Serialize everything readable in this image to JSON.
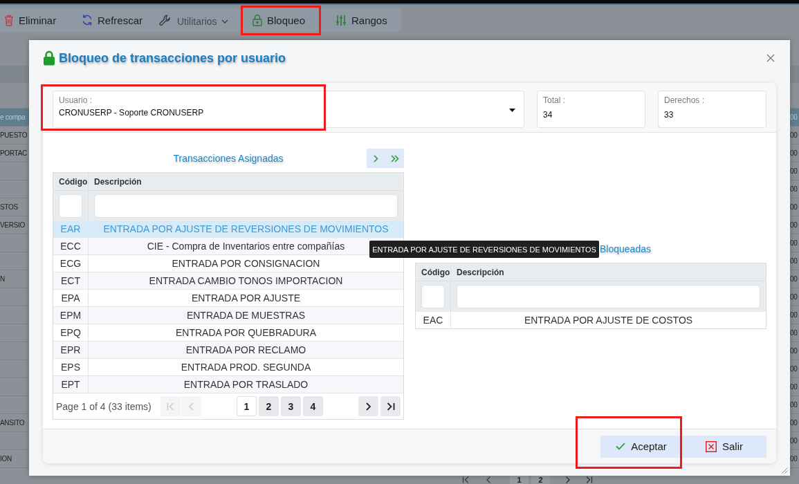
{
  "toolbar": {
    "items": [
      {
        "label": "Eliminar",
        "kind": "delete",
        "disabled": false,
        "highlighted": false
      },
      {
        "label": "Refrescar",
        "kind": "refresh",
        "disabled": false,
        "highlighted": false
      },
      {
        "label": "Utilitarios",
        "kind": "tools",
        "disabled": true,
        "highlighted": false
      },
      {
        "label": "Bloqueo",
        "kind": "lock",
        "disabled": false,
        "highlighted": true
      },
      {
        "label": "Rangos",
        "kind": "ranges",
        "disabled": false,
        "highlighted": false
      }
    ]
  },
  "background_grid": {
    "rows": [
      {
        "column_1": "e compa",
        "column_2": "00",
        "selected": true
      },
      {
        "column_1": "PUESTO",
        "column_2": "00",
        "selected": false
      },
      {
        "column_1": "PORTAC",
        "column_2": "00",
        "selected": false
      },
      {
        "column_2": "00",
        "selected": false
      },
      {
        "column_2": "00",
        "selected": false
      },
      {
        "column_1": "STOS",
        "column_2": "00",
        "selected": false
      },
      {
        "column_1": "VERSIO",
        "column_2": "00",
        "selected": false
      },
      {
        "column_2": "00",
        "selected": false
      },
      {
        "column_2": "00",
        "selected": false
      },
      {
        "column_1": "N",
        "column_2": "00",
        "selected": false
      },
      {
        "column_2": "00",
        "selected": false
      },
      {
        "column_2": "00",
        "selected": false
      },
      {
        "column_2": "00",
        "selected": false
      },
      {
        "column_2": "00",
        "selected": false
      },
      {
        "column_2": "00",
        "selected": false
      },
      {
        "column_2": "00",
        "selected": false
      },
      {
        "column_2": "00",
        "selected": false
      },
      {
        "column_1": "ANSITO",
        "column_2": "00",
        "selected": false
      },
      {
        "column_2": "00",
        "selected": false
      },
      {
        "column_1": "ION",
        "column_2": "00",
        "selected": false
      }
    ],
    "pager": {
      "pages": [
        "1",
        "2"
      ]
    }
  },
  "dialog": {
    "title": "Bloqueo de transacciones por usuario",
    "user_field": {
      "label": "Usuario :",
      "value": "CRONUSERP - Soporte CRONUSERP",
      "highlighted": true
    },
    "stats": [
      {
        "label": "Total :",
        "value": "34"
      },
      {
        "label": "Derechos :",
        "value": "33"
      }
    ],
    "assigned": {
      "title": "Transacciones Asignadas",
      "columns": [
        "Código",
        "Descripción"
      ],
      "rows": [
        {
          "code": "EAR",
          "description": "ENTRADA POR AJUSTE DE REVERSIONES DE MOVIMIENTOS",
          "selected": true
        },
        {
          "code": "ECC",
          "description": "CIE - Compra de Inventarios entre compañías",
          "selected": false
        },
        {
          "code": "ECG",
          "description": "ENTRADA POR CONSIGNACION",
          "selected": false
        },
        {
          "code": "ECT",
          "description": "ENTRADA CAMBIO TONOS IMPORTACION",
          "selected": false
        },
        {
          "code": "EPA",
          "description": "ENTRADA POR AJUSTE",
          "selected": false
        },
        {
          "code": "EPM",
          "description": "ENTRADA DE MUESTRAS",
          "selected": false
        },
        {
          "code": "EPQ",
          "description": "ENTRADA POR QUEBRADURA",
          "selected": false
        },
        {
          "code": "EPR",
          "description": "ENTRADA POR RECLAMO",
          "selected": false
        },
        {
          "code": "EPS",
          "description": "ENTRADA PROD. SEGUNDA",
          "selected": false
        },
        {
          "code": "EPT",
          "description": "ENTRADA POR TRASLADO",
          "selected": false
        }
      ],
      "pager": {
        "summary": "Page 1 of 4 (33 items)",
        "nav_back": [
          {
            "kind": "first",
            "disabled": true
          },
          {
            "kind": "previous",
            "disabled": true
          }
        ],
        "pages": [
          {
            "label": "1",
            "selected": true
          },
          {
            "label": "2",
            "selected": false
          },
          {
            "label": "3",
            "selected": false
          },
          {
            "label": "4",
            "selected": false
          }
        ],
        "nav_forward": [
          {
            "kind": "next",
            "disabled": false
          },
          {
            "kind": "last",
            "disabled": false
          }
        ]
      }
    },
    "blocked": {
      "title": "Bloqueadas",
      "columns": [
        "Código",
        "Descripción"
      ],
      "rows": [
        {
          "code": "EAC",
          "description": "ENTRADA POR AJUSTE DE COSTOS",
          "selected": false
        }
      ]
    },
    "tooltip": "ENTRADA POR AJUSTE DE REVERSIONES DE MOVIMIENTOS",
    "buttons": [
      {
        "label": "Aceptar",
        "kind": "confirm",
        "highlighted": true
      },
      {
        "label": "Salir",
        "kind": "exit",
        "highlighted": false
      }
    ]
  }
}
